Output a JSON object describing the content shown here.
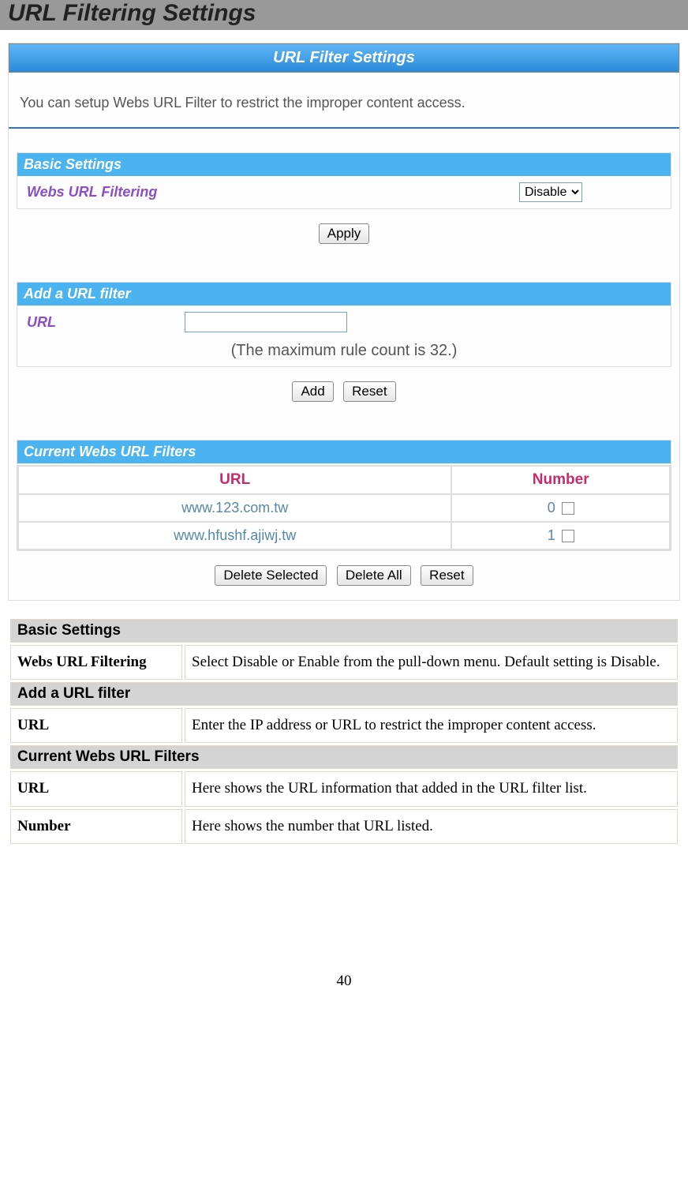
{
  "page": {
    "title": "URL Filtering Settings",
    "number": "40"
  },
  "panel": {
    "title": "URL Filter Settings",
    "intro": "You can setup Webs URL Filter to restrict the improper content access."
  },
  "basic": {
    "header": "Basic Settings",
    "label": "Webs URL Filtering",
    "select_value": "Disable",
    "apply": "Apply"
  },
  "addfilter": {
    "header": "Add a URL filter",
    "label": "URL",
    "hint": "(The maximum rule count is 32.)",
    "add": "Add",
    "reset": "Reset"
  },
  "current": {
    "header": "Current Webs URL Filters",
    "col_url": "URL",
    "col_number": "Number",
    "rows": [
      {
        "url": "www.123.com.tw",
        "number": "0"
      },
      {
        "url": "www.hfushf.ajiwj.tw",
        "number": "1"
      }
    ],
    "delete_selected": "Delete Selected",
    "delete_all": "Delete All",
    "reset": "Reset"
  },
  "desc": {
    "sec1": "Basic Settings",
    "r1k": "Webs URL Filtering",
    "r1v": "Select Disable or Enable from the pull-down menu. Default setting is Disable.",
    "sec2": "Add a URL filter",
    "r2k": "URL",
    "r2v": "Enter the IP address or URL to restrict the improper content access.",
    "sec3": "Current Webs URL Filters",
    "r3k": "URL",
    "r3v": "Here shows the URL information that added in the URL filter list.",
    "r4k": "Number",
    "r4v": "Here shows the number that URL listed."
  }
}
